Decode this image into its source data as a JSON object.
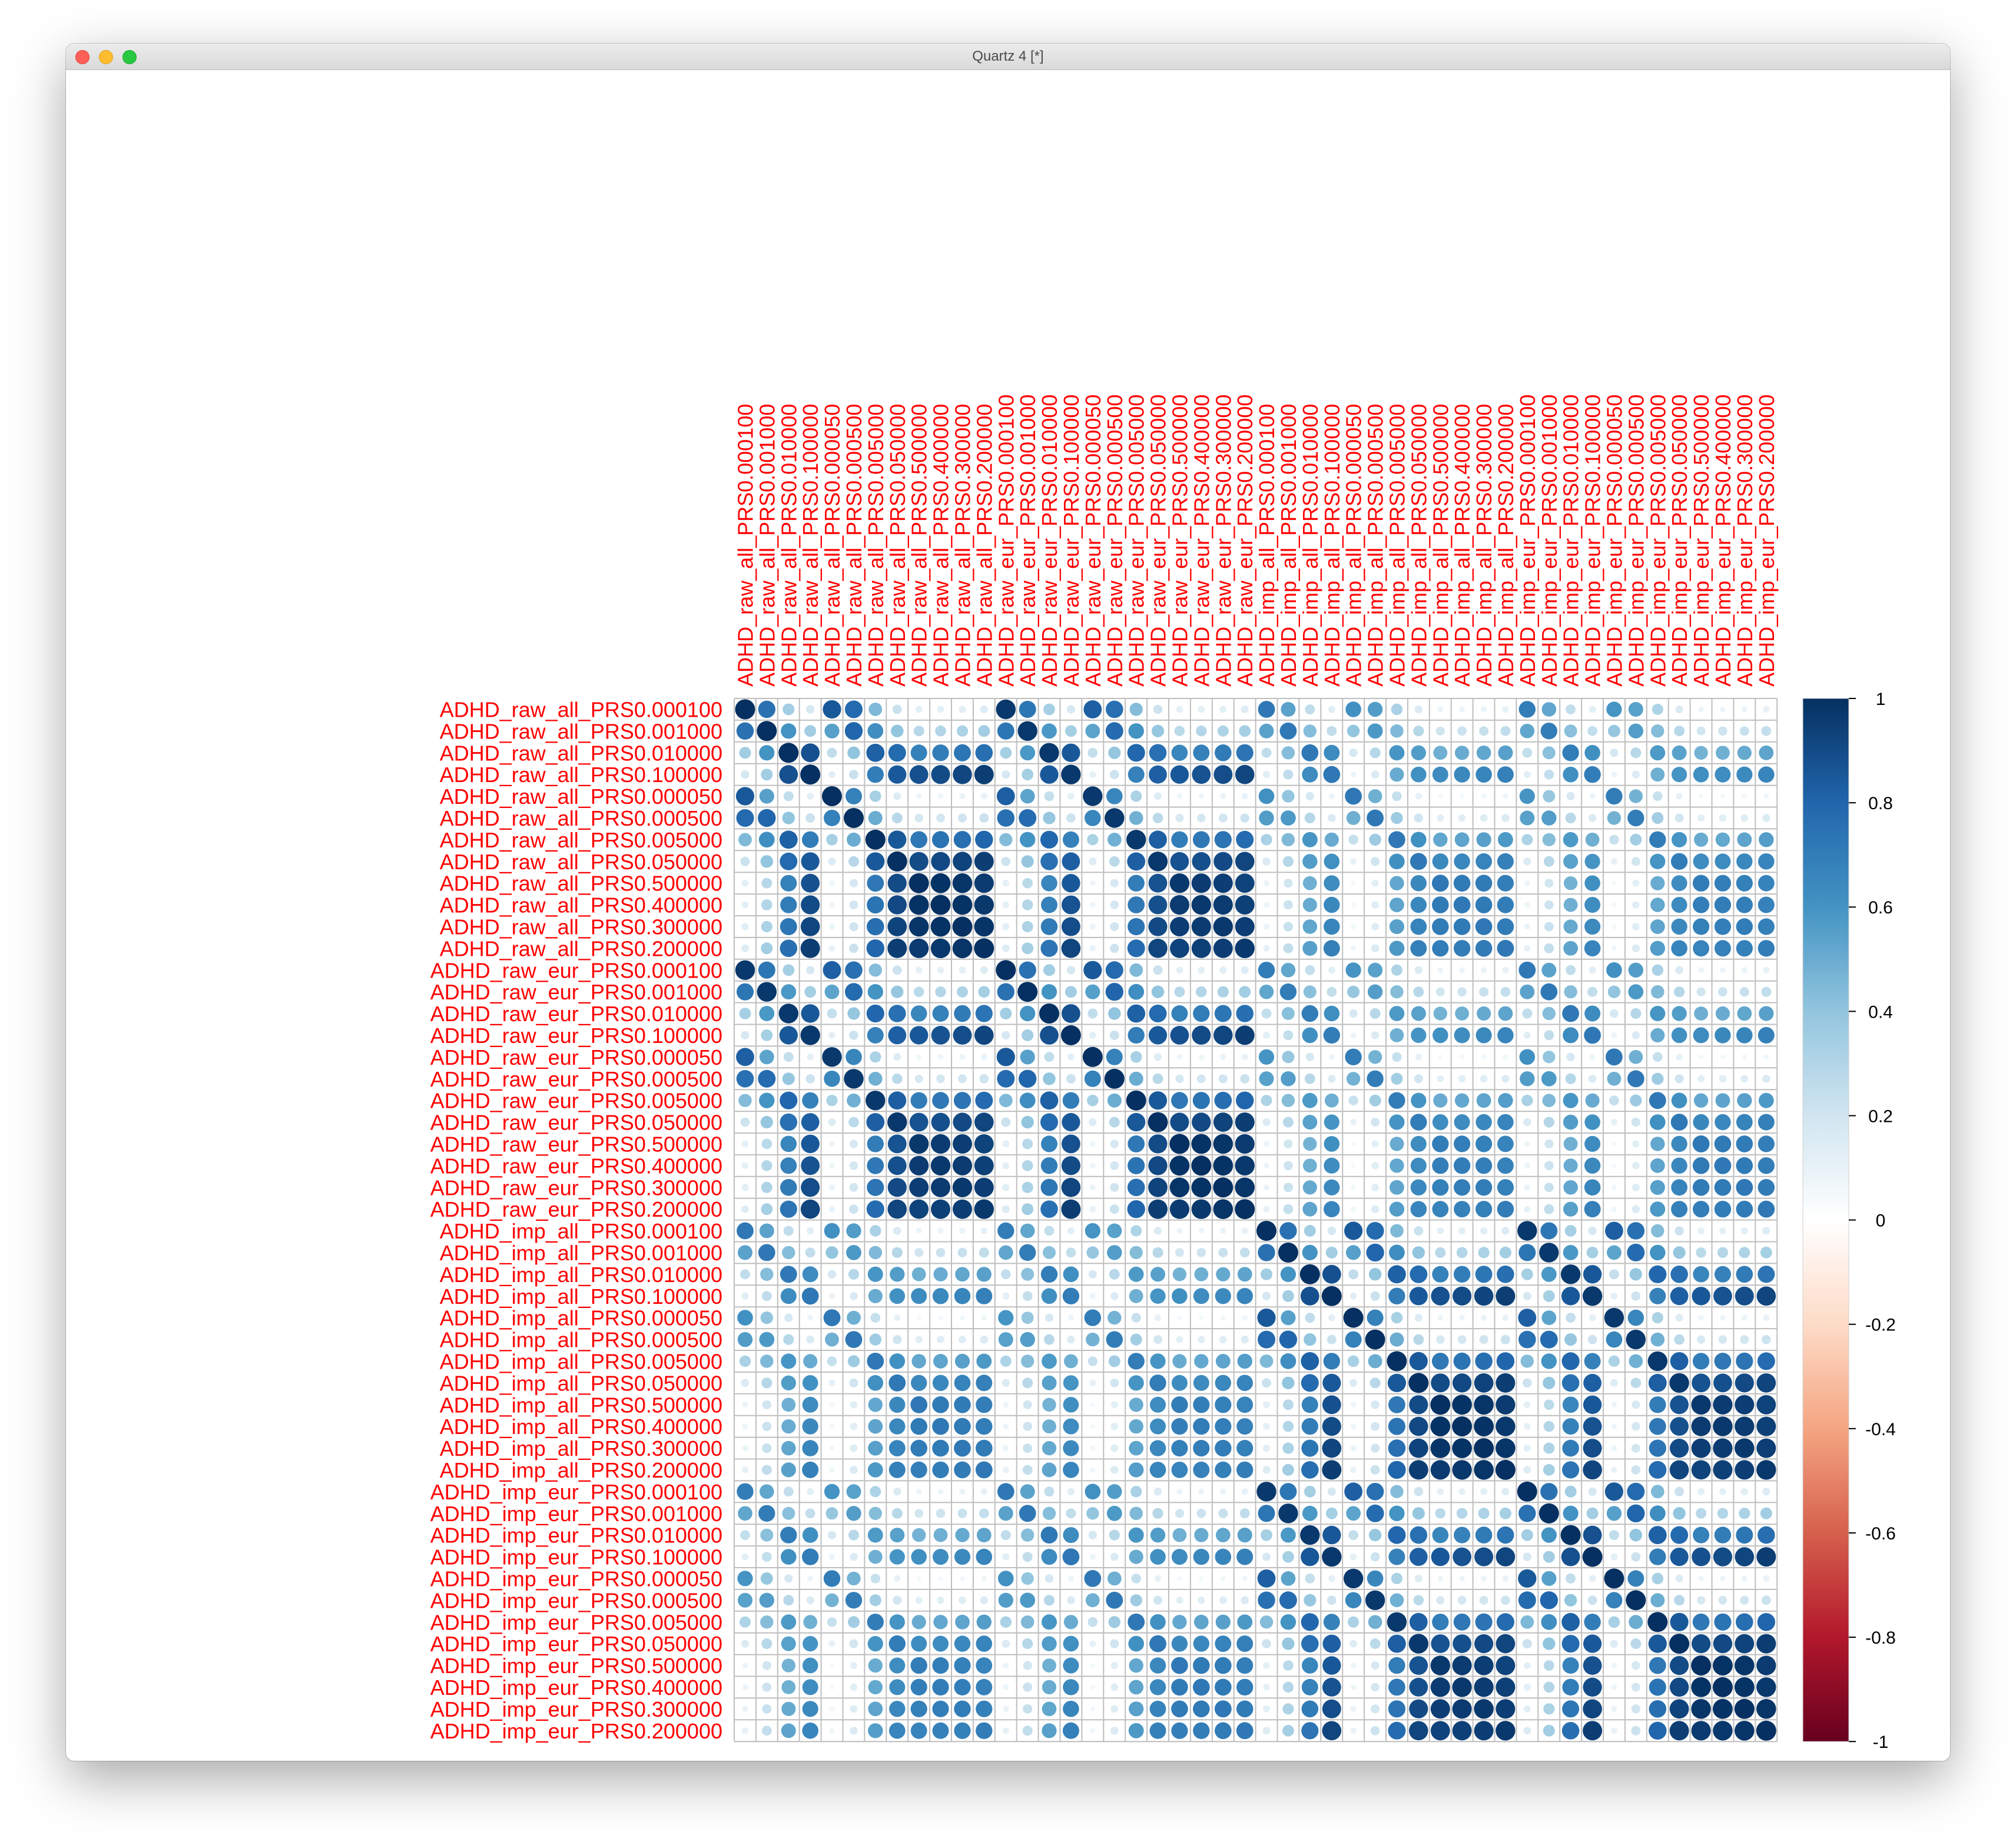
{
  "window": {
    "title": "Quartz 4 [*]",
    "controls": [
      "close",
      "minimize",
      "zoom"
    ]
  },
  "chart_data": {
    "type": "heatmap",
    "style": "corrplot-circle",
    "title": "",
    "label_color": "#ff0000",
    "grid": true,
    "legend_placement": "right",
    "color_scale": {
      "min": -1,
      "max": 1,
      "ticks": [
        "1",
        "0.8",
        "0.6",
        "0.4",
        "0.2",
        "0",
        "-0.2",
        "-0.4",
        "-0.6",
        "-0.8",
        "-1"
      ],
      "colors": [
        "#67001f",
        "#b2182b",
        "#d6604d",
        "#f4a582",
        "#fddbc7",
        "#ffffff",
        "#d1e5f0",
        "#92c5de",
        "#4393c3",
        "#2166ac",
        "#053061"
      ]
    },
    "variables": [
      "ADHD_raw_all_PRS0.000100",
      "ADHD_raw_all_PRS0.001000",
      "ADHD_raw_all_PRS0.010000",
      "ADHD_raw_all_PRS0.100000",
      "ADHD_raw_all_PRS0.000050",
      "ADHD_raw_all_PRS0.000500",
      "ADHD_raw_all_PRS0.005000",
      "ADHD_raw_all_PRS0.050000",
      "ADHD_raw_all_PRS0.500000",
      "ADHD_raw_all_PRS0.400000",
      "ADHD_raw_all_PRS0.300000",
      "ADHD_raw_all_PRS0.200000",
      "ADHD_raw_eur_PRS0.000100",
      "ADHD_raw_eur_PRS0.001000",
      "ADHD_raw_eur_PRS0.010000",
      "ADHD_raw_eur_PRS0.100000",
      "ADHD_raw_eur_PRS0.000050",
      "ADHD_raw_eur_PRS0.000500",
      "ADHD_raw_eur_PRS0.005000",
      "ADHD_raw_eur_PRS0.050000",
      "ADHD_raw_eur_PRS0.500000",
      "ADHD_raw_eur_PRS0.400000",
      "ADHD_raw_eur_PRS0.300000",
      "ADHD_raw_eur_PRS0.200000",
      "ADHD_imp_all_PRS0.000100",
      "ADHD_imp_all_PRS0.001000",
      "ADHD_imp_all_PRS0.010000",
      "ADHD_imp_all_PRS0.100000",
      "ADHD_imp_all_PRS0.000050",
      "ADHD_imp_all_PRS0.000500",
      "ADHD_imp_all_PRS0.005000",
      "ADHD_imp_all_PRS0.050000",
      "ADHD_imp_all_PRS0.500000",
      "ADHD_imp_all_PRS0.400000",
      "ADHD_imp_all_PRS0.300000",
      "ADHD_imp_all_PRS0.200000",
      "ADHD_imp_eur_PRS0.000100",
      "ADHD_imp_eur_PRS0.001000",
      "ADHD_imp_eur_PRS0.010000",
      "ADHD_imp_eur_PRS0.100000",
      "ADHD_imp_eur_PRS0.000050",
      "ADHD_imp_eur_PRS0.000500",
      "ADHD_imp_eur_PRS0.005000",
      "ADHD_imp_eur_PRS0.050000",
      "ADHD_imp_eur_PRS0.500000",
      "ADHD_imp_eur_PRS0.400000",
      "ADHD_imp_eur_PRS0.300000",
      "ADHD_imp_eur_PRS0.200000"
    ],
    "values_note": "",
    "threshold_block_correlation": [
      [
        1.0,
        0.75,
        0.35,
        0.18,
        0.85,
        0.78,
        0.45,
        0.22,
        0.12,
        0.12,
        0.13,
        0.15
      ],
      [
        0.75,
        1.0,
        0.6,
        0.35,
        0.55,
        0.8,
        0.62,
        0.4,
        0.28,
        0.3,
        0.32,
        0.35
      ],
      [
        0.35,
        0.6,
        1.0,
        0.88,
        0.25,
        0.4,
        0.82,
        0.78,
        0.68,
        0.7,
        0.73,
        0.76
      ],
      [
        0.18,
        0.35,
        0.88,
        1.0,
        0.12,
        0.22,
        0.7,
        0.85,
        0.88,
        0.9,
        0.92,
        0.95
      ],
      [
        0.85,
        0.55,
        0.25,
        0.12,
        1.0,
        0.68,
        0.33,
        0.15,
        0.08,
        0.08,
        0.09,
        0.1
      ],
      [
        0.78,
        0.8,
        0.4,
        0.22,
        0.68,
        1.0,
        0.5,
        0.28,
        0.18,
        0.19,
        0.2,
        0.22
      ],
      [
        0.45,
        0.62,
        0.82,
        0.7,
        0.33,
        0.5,
        1.0,
        0.85,
        0.72,
        0.74,
        0.76,
        0.8
      ],
      [
        0.22,
        0.4,
        0.78,
        0.85,
        0.15,
        0.28,
        0.85,
        1.0,
        0.9,
        0.91,
        0.93,
        0.95
      ],
      [
        0.12,
        0.28,
        0.68,
        0.88,
        0.08,
        0.18,
        0.72,
        0.9,
        1.0,
        0.99,
        0.98,
        0.96
      ],
      [
        0.12,
        0.3,
        0.7,
        0.9,
        0.08,
        0.19,
        0.74,
        0.91,
        0.99,
        1.0,
        0.99,
        0.97
      ],
      [
        0.13,
        0.32,
        0.73,
        0.92,
        0.09,
        0.2,
        0.76,
        0.93,
        0.98,
        0.99,
        1.0,
        0.98
      ],
      [
        0.15,
        0.35,
        0.76,
        0.95,
        0.1,
        0.22,
        0.8,
        0.95,
        0.96,
        0.97,
        0.98,
        1.0
      ]
    ],
    "group_block_factor": [
      [
        1.0,
        0.97,
        0.72,
        0.7
      ],
      [
        0.97,
        1.0,
        0.7,
        0.72
      ],
      [
        0.72,
        0.7,
        1.0,
        0.97
      ],
      [
        0.7,
        0.72,
        0.97,
        1.0
      ]
    ]
  }
}
